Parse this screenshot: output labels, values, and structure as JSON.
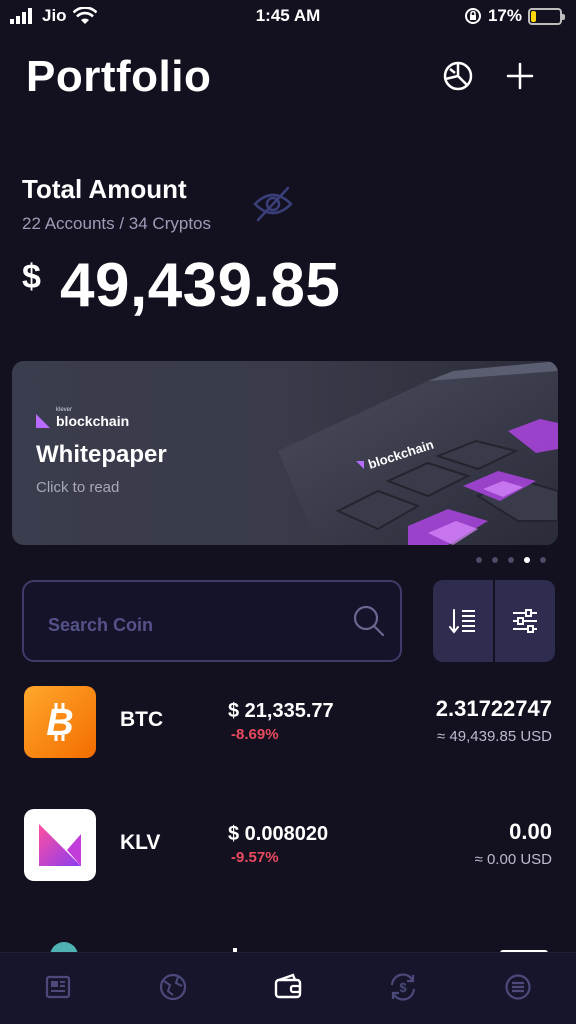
{
  "status_bar": {
    "carrier": "Jio",
    "time": "1:45 AM",
    "battery_percent": "17%",
    "battery_level": 0.17,
    "battery_color": "#ffd60a"
  },
  "header": {
    "title": "Portfolio",
    "icons": [
      "chart-pie-icon",
      "plus-icon"
    ]
  },
  "total": {
    "label": "Total Amount",
    "accounts_line": "22 Accounts / 34 Cryptos",
    "currency": "$",
    "value": "49,439.85"
  },
  "banner": {
    "brand_small": "klever",
    "brand": "blockchain",
    "title": "Whitepaper",
    "subtitle": "Click to read",
    "art_brand": "blockchain",
    "page_count": 5,
    "active_page": 3
  },
  "search": {
    "placeholder": "Search Coin"
  },
  "coins": [
    {
      "symbol": "BTC",
      "price": "$ 21,335.77",
      "change": "-8.69%",
      "amount": "2.31722747",
      "fiat": "≈ 49,439.85 USD",
      "logo_color": "#f7931a",
      "icon": "bitcoin-icon"
    },
    {
      "symbol": "KLV",
      "price": "$ 0.008020",
      "change": "-9.57%",
      "amount": "0.00",
      "fiat": "≈ 0.00 USD",
      "logo_color": "#ffffff",
      "icon": "klever-icon"
    }
  ],
  "tab_bar": {
    "tabs": [
      "news-icon",
      "explore-icon",
      "wallet-icon",
      "exchange-icon",
      "menu-icon"
    ],
    "active": 2
  },
  "colors": {
    "background": "#13111f",
    "accent": "#2e2d4f",
    "negative": "#e84a5f"
  }
}
